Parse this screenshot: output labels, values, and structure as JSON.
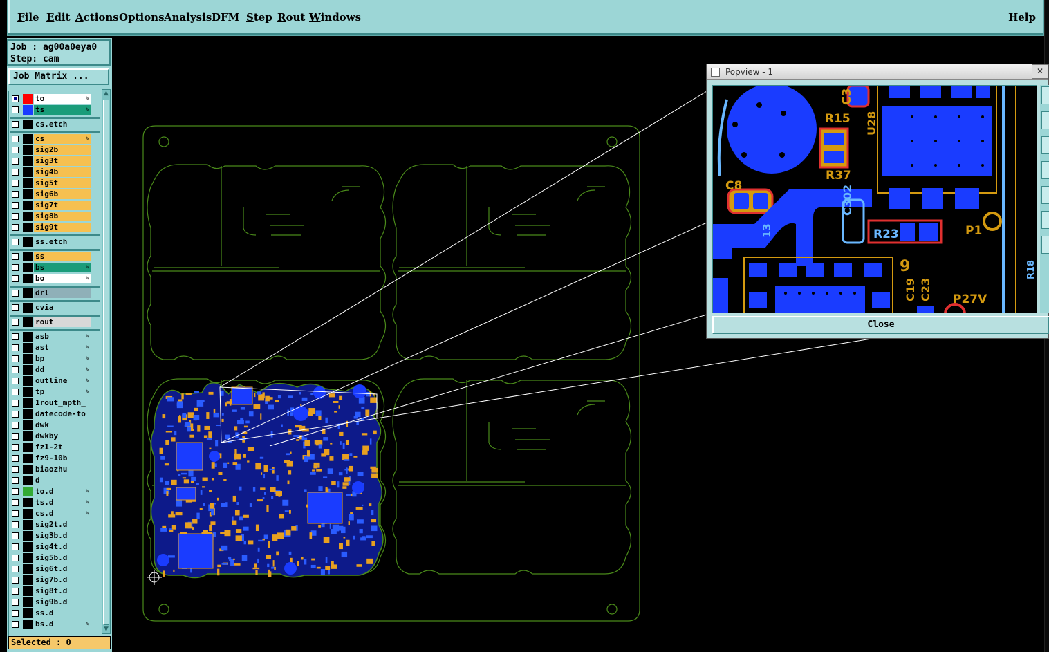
{
  "menu": {
    "items": [
      "File",
      "Edit",
      "Actions",
      "Options",
      "Analysis",
      "DFM",
      "Step",
      "Rout",
      "Windows"
    ],
    "help": "Help"
  },
  "job": {
    "job_line": "Job : ag00a0eya0",
    "step_line": "Step: cam"
  },
  "job_matrix_button": "Job Matrix ...",
  "layers": [
    {
      "name": "to",
      "color": "#ffffff",
      "swatch": "#ff0000",
      "checked": true,
      "editable": true
    },
    {
      "name": "ts",
      "color": "#1a9c7a",
      "swatch": "#1a3cff",
      "checked": false,
      "editable": true
    },
    {
      "name": "cs.etch",
      "color": "#9cd6d6",
      "swatch": "#000000",
      "checked": false
    },
    {
      "name": "cs",
      "color": "#f6c050",
      "swatch": "#000000",
      "checked": false,
      "editable": true
    },
    {
      "name": "sig2b",
      "color": "#f6c050",
      "swatch": "#000000",
      "checked": false
    },
    {
      "name": "sig3t",
      "color": "#f6c050",
      "swatch": "#000000",
      "checked": false
    },
    {
      "name": "sig4b",
      "color": "#f6c050",
      "swatch": "#000000",
      "checked": false
    },
    {
      "name": "sig5t",
      "color": "#f6c050",
      "swatch": "#000000",
      "checked": false
    },
    {
      "name": "sig6b",
      "color": "#f6c050",
      "swatch": "#000000",
      "checked": false
    },
    {
      "name": "sig7t",
      "color": "#f6c050",
      "swatch": "#000000",
      "checked": false
    },
    {
      "name": "sig8b",
      "color": "#f6c050",
      "swatch": "#000000",
      "checked": false
    },
    {
      "name": "sig9t",
      "color": "#f6c050",
      "swatch": "#000000",
      "checked": false
    },
    {
      "name": "ss.etch",
      "color": "#9cd6d6",
      "swatch": "#000000",
      "checked": false
    },
    {
      "name": "ss",
      "color": "#f6c050",
      "swatch": "#000000",
      "checked": false
    },
    {
      "name": "bs",
      "color": "#1a9c7a",
      "swatch": "#000000",
      "checked": false,
      "editable": true
    },
    {
      "name": "bo",
      "color": "#ffffff",
      "swatch": "#000000",
      "checked": false,
      "editable": true
    },
    {
      "name": "drl",
      "color": "#8fb0b8",
      "swatch": "#000000",
      "checked": false
    },
    {
      "name": "cvia",
      "color": "#9cd6d6",
      "swatch": "#000000",
      "checked": false
    },
    {
      "name": "rout",
      "color": "#d8d8d8",
      "swatch": "#000000",
      "checked": false
    },
    {
      "name": "asb",
      "color": "#9cd6d6",
      "swatch": "#000000",
      "checked": false,
      "editable": true
    },
    {
      "name": "ast",
      "color": "#9cd6d6",
      "swatch": "#000000",
      "checked": false,
      "editable": true
    },
    {
      "name": "bp",
      "color": "#9cd6d6",
      "swatch": "#000000",
      "checked": false,
      "editable": true
    },
    {
      "name": "dd",
      "color": "#9cd6d6",
      "swatch": "#000000",
      "checked": false,
      "editable": true
    },
    {
      "name": "outline",
      "color": "#9cd6d6",
      "swatch": "#000000",
      "checked": false,
      "editable": true
    },
    {
      "name": "tp",
      "color": "#9cd6d6",
      "swatch": "#000000",
      "checked": false,
      "editable": true
    },
    {
      "name": "1rout_mpth_",
      "color": "#9cd6d6",
      "swatch": "#000000",
      "checked": false
    },
    {
      "name": "datecode-to",
      "color": "#9cd6d6",
      "swatch": "#000000",
      "checked": false
    },
    {
      "name": "dwk",
      "color": "#9cd6d6",
      "swatch": "#000000",
      "checked": false
    },
    {
      "name": "dwkby",
      "color": "#9cd6d6",
      "swatch": "#000000",
      "checked": false
    },
    {
      "name": "fz1-2t",
      "color": "#9cd6d6",
      "swatch": "#000000",
      "checked": false
    },
    {
      "name": "fz9-10b",
      "color": "#9cd6d6",
      "swatch": "#000000",
      "checked": false
    },
    {
      "name": "biaozhu",
      "color": "#9cd6d6",
      "swatch": "#000000",
      "checked": false
    },
    {
      "name": "d",
      "color": "#9cd6d6",
      "swatch": "#000000",
      "checked": false
    },
    {
      "name": "to.d",
      "color": "#9cd6d6",
      "swatch": "#33aa33",
      "checked": false,
      "editable": true
    },
    {
      "name": "ts.d",
      "color": "#9cd6d6",
      "swatch": "#000000",
      "checked": false,
      "editable": true
    },
    {
      "name": "cs.d",
      "color": "#9cd6d6",
      "swatch": "#000000",
      "checked": false,
      "editable": true
    },
    {
      "name": "sig2t.d",
      "color": "#9cd6d6",
      "swatch": "#000000",
      "checked": false
    },
    {
      "name": "sig3b.d",
      "color": "#9cd6d6",
      "swatch": "#000000",
      "checked": false
    },
    {
      "name": "sig4t.d",
      "color": "#9cd6d6",
      "swatch": "#000000",
      "checked": false
    },
    {
      "name": "sig5b.d",
      "color": "#9cd6d6",
      "swatch": "#000000",
      "checked": false
    },
    {
      "name": "sig6t.d",
      "color": "#9cd6d6",
      "swatch": "#000000",
      "checked": false
    },
    {
      "name": "sig7b.d",
      "color": "#9cd6d6",
      "swatch": "#000000",
      "checked": false
    },
    {
      "name": "sig8t.d",
      "color": "#9cd6d6",
      "swatch": "#000000",
      "checked": false
    },
    {
      "name": "sig9b.d",
      "color": "#9cd6d6",
      "swatch": "#000000",
      "checked": false
    },
    {
      "name": "ss.d",
      "color": "#9cd6d6",
      "swatch": "#000000",
      "checked": false
    },
    {
      "name": "bs.d",
      "color": "#9cd6d6",
      "swatch": "#000000",
      "checked": false,
      "editable": true
    }
  ],
  "status": {
    "selected": "Selected : 0"
  },
  "popview": {
    "title": "Popview - 1",
    "close_button": "Close",
    "refdes": [
      "C3",
      "R15",
      "U28",
      "R37",
      "C8",
      "C302",
      "R23",
      "P1",
      "13",
      "9",
      "C19",
      "C23",
      "P27V",
      "R18"
    ]
  },
  "colors": {
    "panel_bg": "#9cd6d6",
    "board_outline": "#4a8a1a",
    "copper_blue": "#1a3cff",
    "trace_orange": "#e8a020",
    "status_bg": "#f6c86a"
  }
}
